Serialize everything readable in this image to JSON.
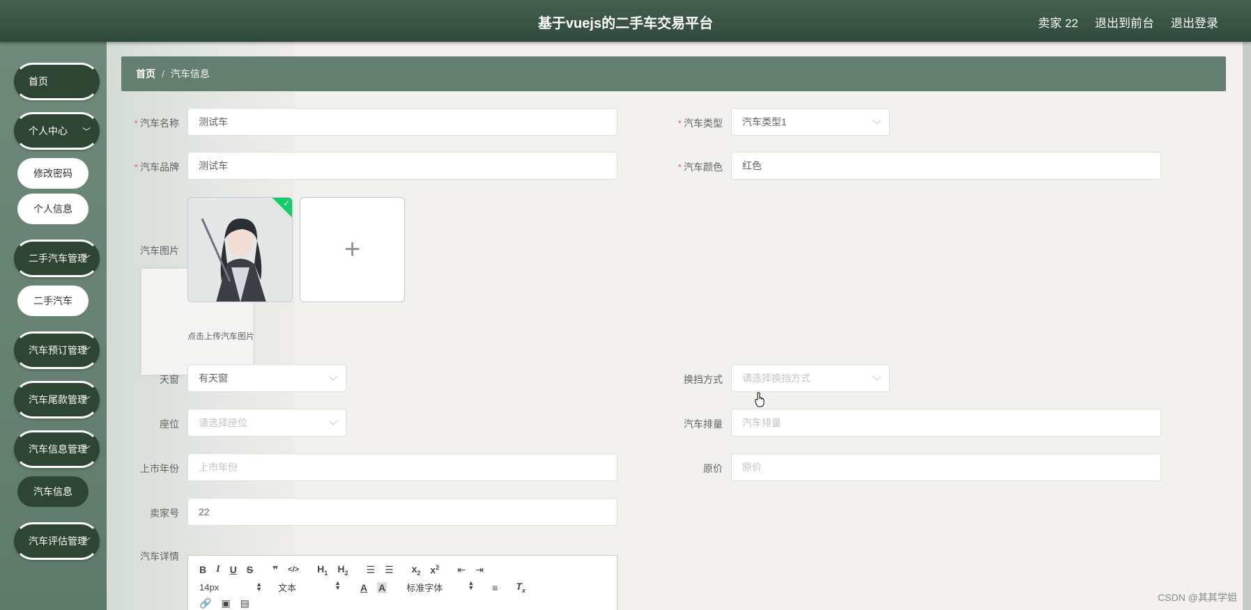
{
  "header": {
    "title": "基于vuejs的二手车交易平台",
    "user": "卖家 22",
    "back_front": "退出到前台",
    "logout": "退出登录"
  },
  "sidebar": {
    "home": "首页",
    "personal_center": "个人中心",
    "change_password": "修改密码",
    "personal_info": "个人信息",
    "used_car_mgmt": "二手汽车管理",
    "used_car": "二手汽车",
    "booking_mgmt": "汽车预订管理",
    "balance_mgmt": "汽车尾款管理",
    "info_mgmt": "汽车信息管理",
    "car_info": "汽车信息",
    "assessment_mgmt": "汽车评估管理"
  },
  "breadcrumb": {
    "home": "首页",
    "separator": "/",
    "current": "汽车信息"
  },
  "form": {
    "car_name": {
      "label": "汽车名称",
      "value": "测试车"
    },
    "car_type": {
      "label": "汽车类型",
      "value": "汽车类型1"
    },
    "car_brand": {
      "label": "汽车品牌",
      "value": "测试车"
    },
    "car_color": {
      "label": "汽车颜色",
      "value": "红色"
    },
    "car_image": {
      "label": "汽车图片",
      "tip": "点击上传汽车图片"
    },
    "sunroof": {
      "label": "天窗",
      "value": "有天窗"
    },
    "transmission": {
      "label": "换挡方式",
      "placeholder": "请选择换挡方式"
    },
    "seats": {
      "label": "座位",
      "placeholder": "请选择座位"
    },
    "displacement": {
      "label": "汽车排量",
      "placeholder": "汽车排量"
    },
    "launch_year": {
      "label": "上市年份",
      "placeholder": "上市年份"
    },
    "original_price": {
      "label": "原价",
      "placeholder": "原价"
    },
    "seller_no": {
      "label": "卖家号",
      "value": "22"
    },
    "details": {
      "label": "汽车详情"
    }
  },
  "editor": {
    "font_size": "14px",
    "text_type": "文本",
    "font_family": "标准字体"
  },
  "watermark": "CSDN @其其学姐",
  "colors": {
    "header_bg": "#2f4a3a",
    "sidebar_bg": "#6f8a7b",
    "menu_bg": "#2f4534",
    "breadcrumb_bg": "#647e6f",
    "required": "#f56c6c"
  }
}
